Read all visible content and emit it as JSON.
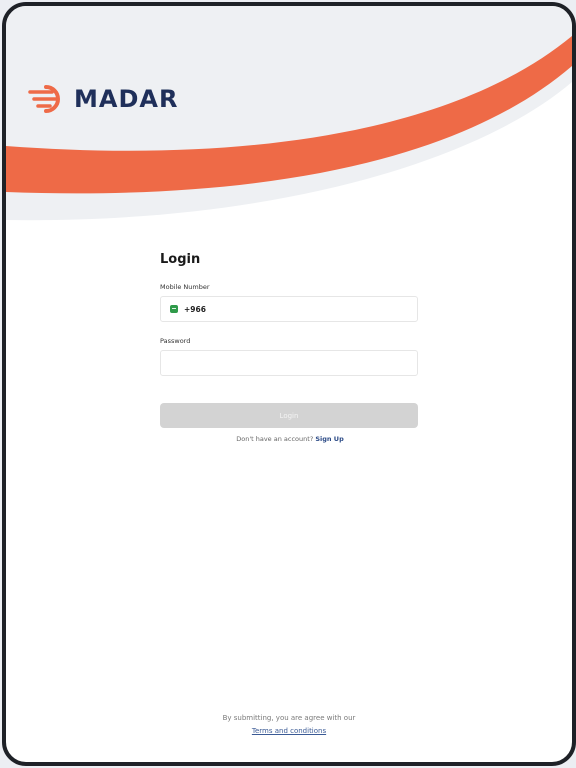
{
  "brand": {
    "name": "MADAR",
    "logo_icon": "madar-logo-icon",
    "colors": {
      "accent": "#ee6a47",
      "navy": "#1f2f5a",
      "header_gray": "#eef0f3"
    }
  },
  "login": {
    "title": "Login",
    "mobile": {
      "label": "Mobile Number",
      "country_flag_icon": "saudi-flag-icon",
      "dial_code": "+966"
    },
    "password": {
      "label": "Password",
      "value": ""
    },
    "submit_label": "Login",
    "signup_prompt": "Don't have an account?",
    "signup_link": "Sign Up"
  },
  "footer": {
    "notice": "By submitting, you are agree with our",
    "terms_link": "Terms and conditions"
  }
}
